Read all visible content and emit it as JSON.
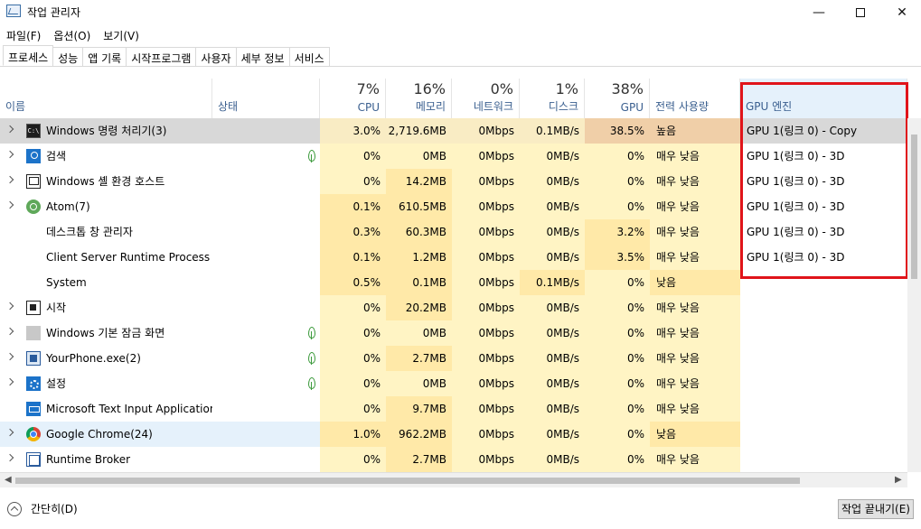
{
  "window": {
    "title": "작업 관리자",
    "minimize": "—",
    "close": "✕"
  },
  "menu": [
    "파일(F)",
    "옵션(O)",
    "보기(V)"
  ],
  "tabs": [
    "프로세스",
    "성능",
    "앱 기록",
    "시작프로그램",
    "사용자",
    "세부 정보",
    "서비스"
  ],
  "active_tab": "프로세스",
  "header": {
    "name": "이름",
    "status": "상태",
    "cpu": {
      "pct": "7%",
      "label": "CPU"
    },
    "memory": {
      "pct": "16%",
      "label": "메모리"
    },
    "network": {
      "pct": "0%",
      "label": "네트워크"
    },
    "disk": {
      "pct": "1%",
      "label": "디스크"
    },
    "gpu": {
      "pct": "38%",
      "label": "GPU"
    },
    "power": "전력 사용량",
    "gpu_engine": "GPU 엔진"
  },
  "rows": [
    {
      "name": "Windows 명령 처리기(3)",
      "icon": "cmd-icon",
      "expandable": true,
      "leaf": false,
      "cpu": "3.0%",
      "mem": "2,719.6MB",
      "net": "0Mbps",
      "disk": "0.1MB/s",
      "gpu": "38.5%",
      "power": "높음",
      "engine": "GPU 1(링크 0) - Copy"
    },
    {
      "name": "검색",
      "icon": "search-icon",
      "expandable": true,
      "leaf": true,
      "cpu": "0%",
      "mem": "0MB",
      "net": "0Mbps",
      "disk": "0MB/s",
      "gpu": "0%",
      "power": "매우 낮음",
      "engine": "GPU 1(링크 0) - 3D"
    },
    {
      "name": "Windows 셸 환경 호스트",
      "icon": "shell-icon",
      "expandable": true,
      "leaf": false,
      "cpu": "0%",
      "mem": "14.2MB",
      "net": "0Mbps",
      "disk": "0MB/s",
      "gpu": "0%",
      "power": "매우 낮음",
      "engine": "GPU 1(링크 0) - 3D"
    },
    {
      "name": "Atom(7)",
      "icon": "atom-icon",
      "expandable": true,
      "leaf": false,
      "cpu": "0.1%",
      "mem": "610.5MB",
      "net": "0Mbps",
      "disk": "0MB/s",
      "gpu": "0%",
      "power": "매우 낮음",
      "engine": "GPU 1(링크 0) - 3D"
    },
    {
      "name": "데스크톱 창 관리자",
      "icon": "dwm-icon",
      "expandable": false,
      "leaf": false,
      "cpu": "0.3%",
      "mem": "60.3MB",
      "net": "0Mbps",
      "disk": "0MB/s",
      "gpu": "3.2%",
      "power": "매우 낮음",
      "engine": "GPU 1(링크 0) - 3D"
    },
    {
      "name": "Client Server Runtime Process",
      "icon": "csrss-icon",
      "expandable": false,
      "leaf": false,
      "cpu": "0.1%",
      "mem": "1.2MB",
      "net": "0Mbps",
      "disk": "0MB/s",
      "gpu": "3.5%",
      "power": "매우 낮음",
      "engine": "GPU 1(링크 0) - 3D"
    },
    {
      "name": "System",
      "icon": "system-icon",
      "expandable": false,
      "leaf": false,
      "cpu": "0.5%",
      "mem": "0.1MB",
      "net": "0Mbps",
      "disk": "0.1MB/s",
      "gpu": "0%",
      "power": "낮음",
      "engine": ""
    },
    {
      "name": "시작",
      "icon": "start-icon",
      "expandable": true,
      "leaf": false,
      "cpu": "0%",
      "mem": "20.2MB",
      "net": "0Mbps",
      "disk": "0MB/s",
      "gpu": "0%",
      "power": "매우 낮음",
      "engine": ""
    },
    {
      "name": "Windows 기본 잠금 화면",
      "icon": "lockscreen-icon",
      "expandable": true,
      "leaf": true,
      "cpu": "0%",
      "mem": "0MB",
      "net": "0Mbps",
      "disk": "0MB/s",
      "gpu": "0%",
      "power": "매우 낮음",
      "engine": ""
    },
    {
      "name": "YourPhone.exe(2)",
      "icon": "phone-icon",
      "expandable": true,
      "leaf": true,
      "cpu": "0%",
      "mem": "2.7MB",
      "net": "0Mbps",
      "disk": "0MB/s",
      "gpu": "0%",
      "power": "매우 낮음",
      "engine": ""
    },
    {
      "name": "설정",
      "icon": "settings-icon",
      "expandable": true,
      "leaf": true,
      "cpu": "0%",
      "mem": "0MB",
      "net": "0Mbps",
      "disk": "0MB/s",
      "gpu": "0%",
      "power": "매우 낮음",
      "engine": ""
    },
    {
      "name": "Microsoft Text Input Application",
      "icon": "text-input-icon",
      "expandable": false,
      "leaf": false,
      "cpu": "0%",
      "mem": "9.7MB",
      "net": "0Mbps",
      "disk": "0MB/s",
      "gpu": "0%",
      "power": "매우 낮음",
      "engine": ""
    },
    {
      "name": "Google Chrome(24)",
      "icon": "chrome-icon",
      "expandable": true,
      "leaf": false,
      "cpu": "1.0%",
      "mem": "962.2MB",
      "net": "0Mbps",
      "disk": "0MB/s",
      "gpu": "0%",
      "power": "낮음",
      "engine": ""
    },
    {
      "name": "Runtime Broker",
      "icon": "broker-icon",
      "expandable": true,
      "leaf": false,
      "cpu": "0%",
      "mem": "2.7MB",
      "net": "0Mbps",
      "disk": "0MB/s",
      "gpu": "0%",
      "power": "매우 낮음",
      "engine": ""
    }
  ],
  "footer": {
    "fewer_details": "간단히(D)",
    "end_task": "작업 끝내기(E)"
  },
  "colors": {
    "highlight_box": "#e0141a",
    "selected_row": "#d8d8d8",
    "heat_light": "#fff4c4",
    "heat_mid": "#ffe9a8",
    "heat_high": "#f0cfa8"
  }
}
